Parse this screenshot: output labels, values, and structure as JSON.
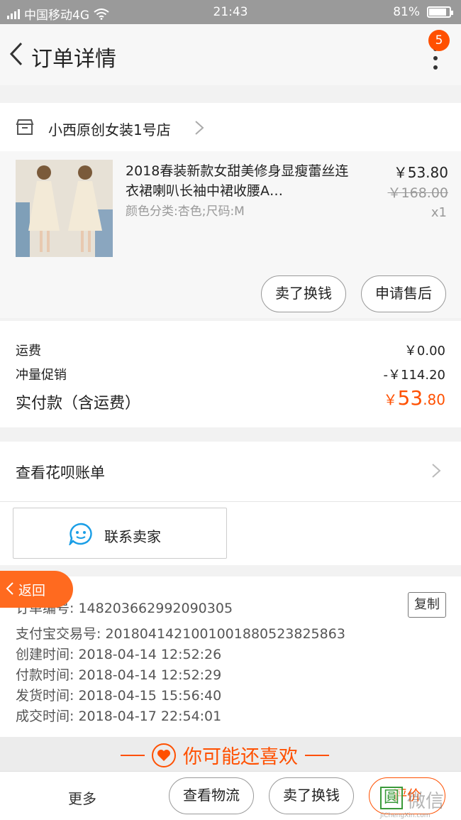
{
  "status_bar": {
    "carrier": "中国移动4G",
    "time": "21:43",
    "battery": "81%"
  },
  "nav": {
    "title": "订单详情",
    "badge": "5"
  },
  "shop": {
    "name": "小西原创女装1号店"
  },
  "item": {
    "title": "2018春装新款女甜美修身显瘦蕾丝连衣裙喇叭长袖中裙收腰A…",
    "spec": "颜色分类:杏色;尺码:M",
    "price": "￥53.80",
    "original_price": "￥168.00",
    "quantity": "x1",
    "sell_label": "卖了换钱",
    "after_sale_label": "申请售后"
  },
  "costs": {
    "shipping_label": "运费",
    "shipping_value": "￥0.00",
    "promo_label": "冲量促销",
    "promo_value": "-￥114.20",
    "total_label": "实付款（含运费）",
    "total_currency": "￥",
    "total_int": "53",
    "total_dec": ".80"
  },
  "huabei": {
    "label": "查看花呗账单"
  },
  "contact": {
    "label": "联系卖家"
  },
  "floating_back": {
    "label": "返回"
  },
  "order_info": {
    "order_no": "订单编号: 148203662992090305",
    "alipay_no": "支付宝交易号: 2018041421001001880523825863",
    "created": "创建时间: 2018-04-14 12:52:26",
    "paid": "付款时间: 2018-04-14 12:52:29",
    "shipped": "发货时间: 2018-04-15 15:56:40",
    "completed": "成交时间: 2018-04-17 22:54:01",
    "copy_label": "复制"
  },
  "recommend": {
    "label": "你可能还喜欢"
  },
  "bottom_bar": {
    "more": "更多",
    "logistics": "查看物流",
    "sell": "卖了换钱",
    "review": "评价"
  },
  "watermark": {
    "glyph": "圓",
    "text": "微信",
    "url": "JiChengXin.com"
  },
  "colors": {
    "accent": "#ff5000",
    "status_bar": "#9a9a9a"
  }
}
